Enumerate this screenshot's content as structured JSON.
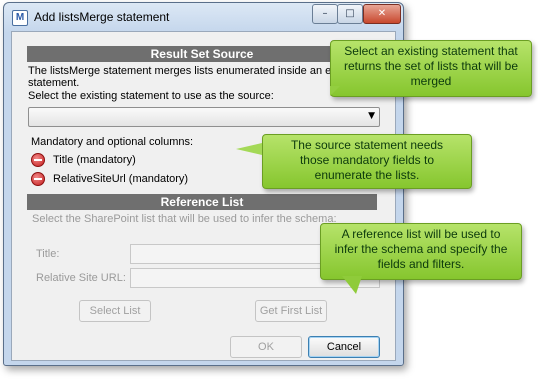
{
  "window": {
    "title": "Add listsMerge statement",
    "icon": "app-icon",
    "icon_glyph": "M"
  },
  "controls": {
    "minimize": "–",
    "maximize": "□",
    "close": "✕"
  },
  "result_set_source": {
    "header": "Result Set Source",
    "description_line1": "The listsMerge statement merges lists enumerated inside an existin",
    "description_line2": "statement.",
    "select_label": "Select the existing statement to use as the source:",
    "select_value": "",
    "columns_label": "Mandatory and optional columns:",
    "columns": [
      {
        "label": "Title (mandatory)",
        "icon": "remove-icon"
      },
      {
        "label": "RelativeSiteUrl (mandatory)",
        "icon": "remove-icon"
      }
    ]
  },
  "reference_list": {
    "header": "Reference List",
    "description": "Select the SharePoint list that will be used to infer the schema:",
    "title_label": "Title:",
    "title_value": "",
    "site_url_label": "Relative Site URL:",
    "site_url_value": "",
    "select_list_button": "Select List",
    "get_first_list_button": "Get First List"
  },
  "footer": {
    "ok_button": "OK",
    "cancel_button": "Cancel"
  },
  "callouts": [
    {
      "line1": "Select an existing statement that",
      "line2": "returns the set of lists that will be",
      "line3": "merged"
    },
    {
      "line1": "The source statement needs",
      "line2": "those mandatory fields to",
      "line3": "enumerate the lists."
    },
    {
      "line1": "A reference list will be used to",
      "line2": "infer the schema and specify the",
      "line3": "fields and filters."
    }
  ],
  "colors": {
    "callout": "#9ad44a",
    "section_header": "#6f6f6f"
  }
}
